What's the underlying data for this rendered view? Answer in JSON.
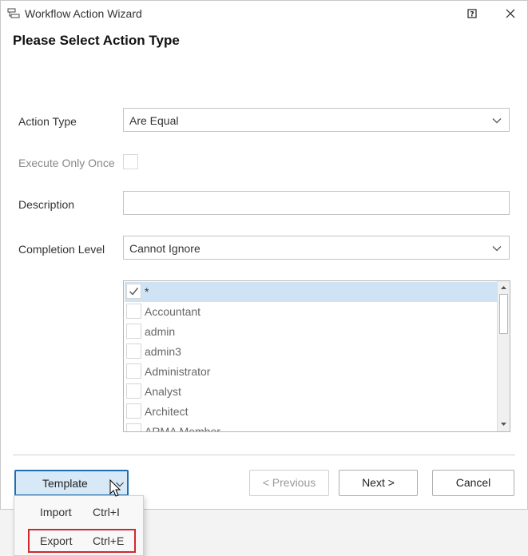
{
  "window": {
    "title": "Workflow Action Wizard",
    "heading": "Please Select Action Type"
  },
  "form": {
    "action_type_label": "Action Type",
    "action_type_value": "Are Equal",
    "execute_once_label": "Execute Only Once",
    "description_label": "Description",
    "description_value": "",
    "completion_level_label": "Completion Level",
    "completion_level_value": "Cannot Ignore"
  },
  "roles": {
    "items": [
      {
        "label": "*",
        "checked": true
      },
      {
        "label": "Accountant",
        "checked": false
      },
      {
        "label": "admin",
        "checked": false
      },
      {
        "label": "admin3",
        "checked": false
      },
      {
        "label": "Administrator",
        "checked": false
      },
      {
        "label": "Analyst",
        "checked": false
      },
      {
        "label": "Architect",
        "checked": false
      },
      {
        "label": "ARMA Member",
        "checked": false
      }
    ]
  },
  "footer": {
    "template_label": "Template",
    "previous_label": "< Previous",
    "next_label": "Next >",
    "cancel_label": "Cancel"
  },
  "template_menu": {
    "items": [
      {
        "label": "Import",
        "shortcut": "Ctrl+I"
      },
      {
        "label": "Export",
        "shortcut": "Ctrl+E"
      }
    ]
  },
  "colors": {
    "selected_row": "#cfe3f5",
    "template_accent": "#1f6fb2",
    "highlight_box": "#d0282e"
  }
}
